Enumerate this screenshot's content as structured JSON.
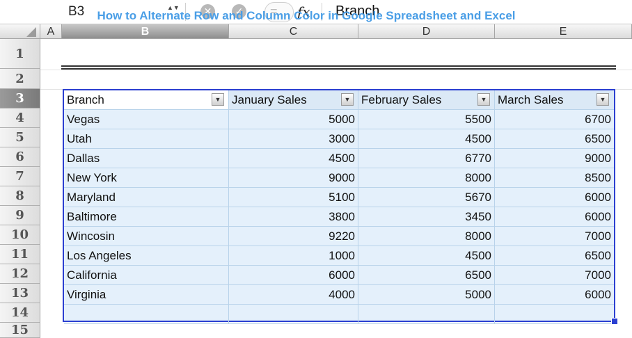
{
  "formula_bar": {
    "cell_ref": "B3",
    "name_box_arrows": "▲▼",
    "cancel_symbol": "✕",
    "confirm_symbol": "✓",
    "insert_symbol": "=",
    "fx_label": "fx",
    "formula": "Branch"
  },
  "columns": [
    "A",
    "B",
    "C",
    "D",
    "E"
  ],
  "rows": [
    "1",
    "2",
    "3",
    "4",
    "5",
    "6",
    "7",
    "8",
    "9",
    "10",
    "11",
    "12",
    "13",
    "14",
    "15"
  ],
  "selected_row": "3",
  "selected_column": "B",
  "title": "How to Alternate Row and Column Color in Google Spreadsheet and Excel",
  "table": {
    "headers": [
      "Branch",
      "January Sales",
      "February Sales",
      "March Sales"
    ],
    "dropdown_symbol": "▼",
    "data": [
      {
        "branch": "Vegas",
        "jan": "5000",
        "feb": "5500",
        "mar": "6700"
      },
      {
        "branch": "Utah",
        "jan": "3000",
        "feb": "4500",
        "mar": "6500"
      },
      {
        "branch": "Dallas",
        "jan": "4500",
        "feb": "6770",
        "mar": "9000"
      },
      {
        "branch": "New York",
        "jan": "9000",
        "feb": "8000",
        "mar": "8500"
      },
      {
        "branch": "Maryland",
        "jan": "5100",
        "feb": "5670",
        "mar": "6000"
      },
      {
        "branch": "Baltimore",
        "jan": "3800",
        "feb": "3450",
        "mar": "6000"
      },
      {
        "branch": "Wincosin",
        "jan": "9220",
        "feb": "8000",
        "mar": "7000"
      },
      {
        "branch": "Los Angeles",
        "jan": "1000",
        "feb": "4500",
        "mar": "6500"
      },
      {
        "branch": "California",
        "jan": "6000",
        "feb": "6500",
        "mar": "7000"
      },
      {
        "branch": "Virginia",
        "jan": "4000",
        "feb": "5000",
        "mar": "6000"
      }
    ]
  },
  "colors": {
    "title": "#4a9ee6",
    "table_border": "#2b3fd1",
    "table_fill": "#e4f0fb"
  }
}
